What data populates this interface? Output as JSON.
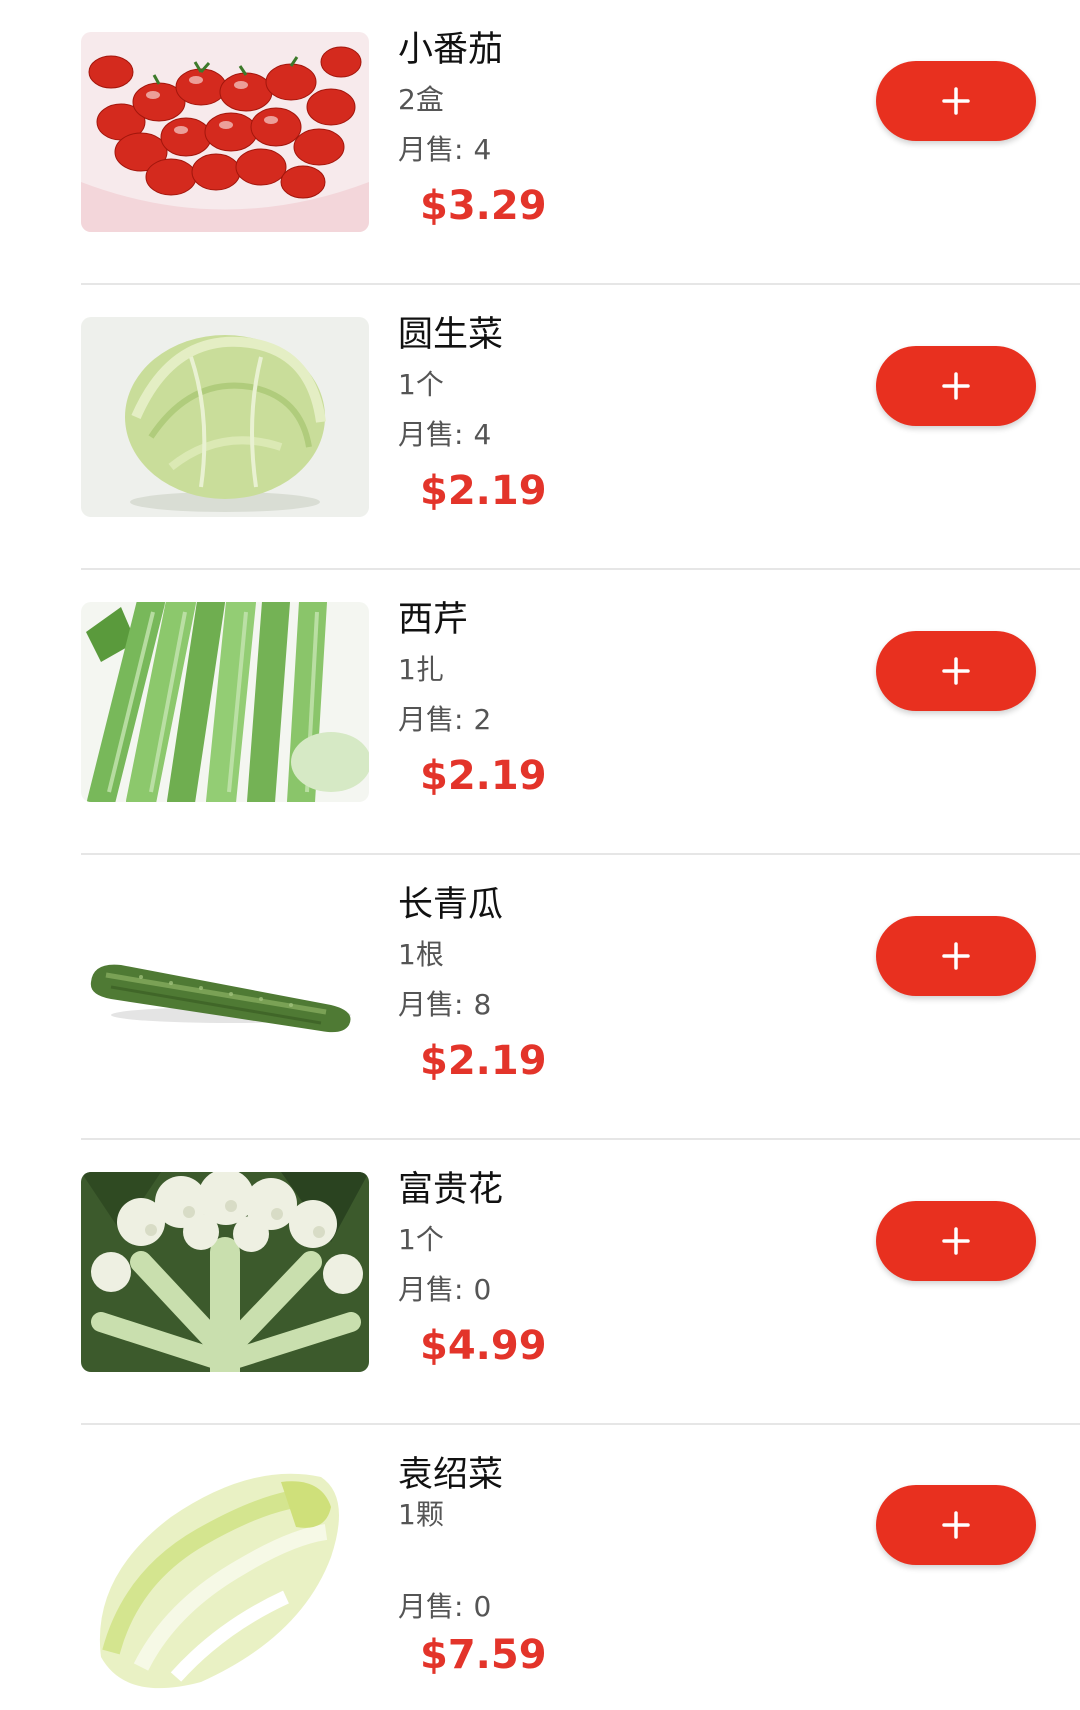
{
  "products": [
    {
      "name": "小番茄",
      "unit": "2盒",
      "sales_label": "月售:",
      "sales": "4",
      "price": "$3.29",
      "image": "cherry-tomatoes"
    },
    {
      "name": "圆生菜",
      "unit": "1个",
      "sales_label": "月售:",
      "sales": "4",
      "price": "$2.19",
      "image": "iceberg-lettuce"
    },
    {
      "name": "西芹",
      "unit": "1扎",
      "sales_label": "月售:",
      "sales": "2",
      "price": "$2.19",
      "image": "celery"
    },
    {
      "name": "长青瓜",
      "unit": "1根",
      "sales_label": "月售:",
      "sales": "8",
      "price": "$2.19",
      "image": "cucumber"
    },
    {
      "name": "富贵花",
      "unit": "1个",
      "sales_label": "月售:",
      "sales": "0",
      "price": "$4.99",
      "image": "cauliflower"
    },
    {
      "name": "袁绍菜",
      "unit": "1颗",
      "sales_label": "月售:",
      "sales": "0",
      "price": "$7.59",
      "image": "napa-cabbage"
    }
  ],
  "add_button": {
    "icon": "plus-icon",
    "color": "#e8301f"
  },
  "colors": {
    "price": "#e3342a",
    "divider": "#e6e6e6"
  }
}
